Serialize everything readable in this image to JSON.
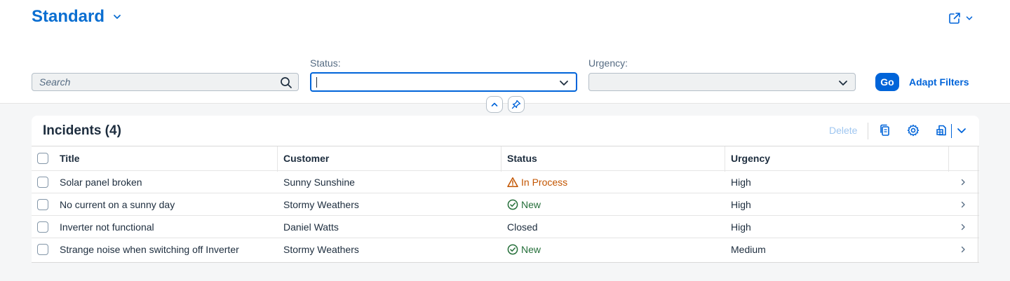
{
  "header": {
    "variant_title": "Standard",
    "share_icon": "share-icon"
  },
  "filters": {
    "search": {
      "placeholder": "Search",
      "value": ""
    },
    "status": {
      "label": "Status:",
      "value": ""
    },
    "urgency": {
      "label": "Urgency:",
      "value": ""
    },
    "go_label": "Go",
    "adapt_label": "Adapt Filters"
  },
  "table": {
    "title": "Incidents (4)",
    "delete_label": "Delete",
    "columns": [
      "Title",
      "Customer",
      "Status",
      "Urgency"
    ],
    "rows": [
      {
        "title": "Solar panel broken",
        "customer": "Sunny Sunshine",
        "status": "In Process",
        "status_kind": "warning",
        "urgency": "High"
      },
      {
        "title": "No current on a sunny day",
        "customer": "Stormy Weathers",
        "status": "New",
        "status_kind": "success",
        "urgency": "High"
      },
      {
        "title": "Inverter not functional",
        "customer": "Daniel Watts",
        "status": "Closed",
        "status_kind": "none",
        "urgency": "High"
      },
      {
        "title": "Strange noise when switching off Inverter",
        "customer": "Stormy Weathers",
        "status": "New",
        "status_kind": "success",
        "urgency": "Medium"
      }
    ]
  },
  "colors": {
    "accent": "#0064d9",
    "title_blue": "#0a6ed1",
    "warning": "#c35500",
    "success": "#256f3a"
  }
}
